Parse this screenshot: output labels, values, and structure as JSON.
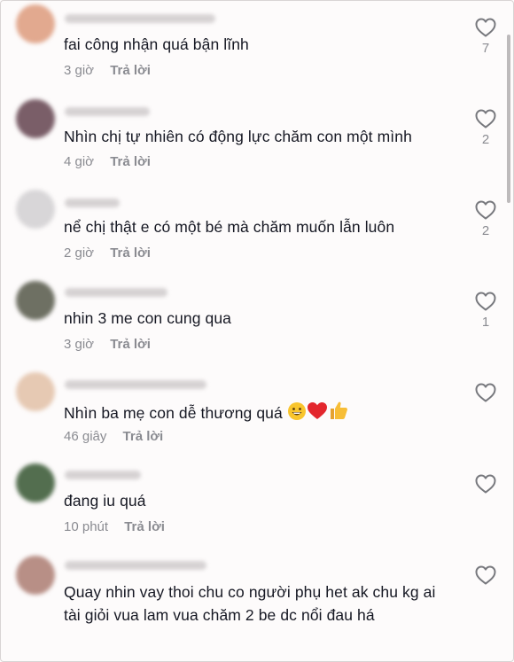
{
  "comments": [
    {
      "text": "fai công nhận quá bận lĩnh",
      "time": "3 giờ",
      "reply_label": "Trả lời",
      "likes": "7",
      "avatar_color": "#e2a98f"
    },
    {
      "text": "Nhìn chị tự nhiên có động lực chăm con một mình",
      "time": "4 giờ",
      "reply_label": "Trả lời",
      "likes": "2",
      "avatar_color": "#7a5e68"
    },
    {
      "text": "nể chị thật e có một bé mà chăm muốn lẫn luôn",
      "time": "2 giờ",
      "reply_label": "Trả lời",
      "likes": "2",
      "avatar_color": "#d8d6d8"
    },
    {
      "text": "nhin 3 me con cung qua",
      "time": "3 giờ",
      "reply_label": "Trả lời",
      "likes": "1",
      "avatar_color": "#6e7063"
    },
    {
      "text": "Nhìn ba mẹ con dễ thương quá",
      "time": "46 giây",
      "reply_label": "Trả lời",
      "likes": "",
      "avatar_color": "#e6c9b3"
    },
    {
      "text": "đang iu quá",
      "time": "10 phút",
      "reply_label": "Trả lời",
      "likes": "",
      "avatar_color": "#536e4f"
    },
    {
      "text": "Quay nhin vay thoi chu co người phụ het ak chu kg ai tài giỏi vua lam vua chăm 2 be dc nổi đau há",
      "time": "",
      "reply_label": "",
      "likes": "",
      "avatar_color": "#b88f86"
    }
  ],
  "icons": {
    "like": "heart-outline-icon",
    "emoji_1": "grinning-face-emoji",
    "emoji_2": "red-heart-emoji",
    "emoji_3": "thumbs-up-emoji"
  },
  "colors": {
    "background": "#fdfbfb",
    "text": "#161823",
    "secondary_text": "#8a8b91"
  }
}
